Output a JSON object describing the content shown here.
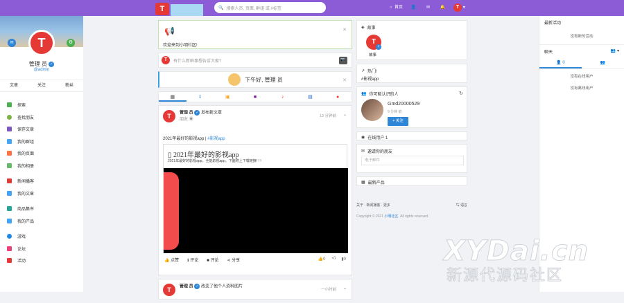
{
  "topbar": {
    "logo_text": "T",
    "search_placeholder": "搜索人员, 页面, 群组 或 #标签",
    "nav_home": "首页",
    "accent": "#8b5cd6"
  },
  "profile": {
    "name": "管理 员",
    "handle": "@admin",
    "tabs": [
      "文章",
      "关注",
      "粉丝"
    ]
  },
  "menu": [
    {
      "label": "探索",
      "color": "#4caf50"
    },
    {
      "label": "查找朋友",
      "color": "#7cb342"
    },
    {
      "label": "保存文章",
      "color": "#7e57c2"
    },
    {
      "label": "我的群组",
      "color": "#42a5f5"
    },
    {
      "label": "我的页面",
      "color": "#ff7043"
    },
    {
      "label": "我的相册",
      "color": "#66bb6a"
    },
    {
      "label": "新闻播客",
      "color": "#e53935"
    },
    {
      "label": "我的文章",
      "color": "#42a5f5"
    },
    {
      "label": "商品集市",
      "color": "#26a69a"
    },
    {
      "label": "我的产品",
      "color": "#42a5f5"
    },
    {
      "label": "游戏",
      "color": "#1e88e5"
    },
    {
      "label": "论坛",
      "color": "#ec407a"
    },
    {
      "label": "活动",
      "color": "#e53935"
    }
  ],
  "center": {
    "welcome": "欢迎来到小明社区!",
    "post_prompt": "有什么新鲜事想告诉大家?",
    "greeting": "下午好, 管理 员",
    "post1": {
      "author": "管理 员",
      "action": "发布新文章",
      "privacy": "朋友",
      "time": "13 分钟前",
      "text": "2021年最好的影视app |",
      "tag": "#影视app",
      "blog_title": "2021年最好的影视app",
      "blog_desc": "2021年最好的影视app。全能影视app。下面附上下载链接! ! !",
      "actions": [
        "点赞",
        "评论"
      ],
      "comment": "评论",
      "share": "分享",
      "likes": "0",
      "comments": "0",
      "shares": "0"
    },
    "post2": {
      "author": "管理 员",
      "action": "改变了他个人资料图片",
      "time": "一小时前"
    }
  },
  "right": {
    "story_title": "故事",
    "story_label": "故事",
    "hot_title": "热门!",
    "hot_tag": "#影视app",
    "pyk_title": "你可能认识的人",
    "pyk_name": "Gmd20000529",
    "pyk_time": "9 分钟 前",
    "pyk_follow": "关注",
    "online_title": "在线用户 1",
    "invite_title": "邀请你的朋友",
    "invite_placeholder": "电子邮件",
    "latest_title": "最新产品",
    "footer_links": "关于 · 新闻播客 · 更多",
    "footer_lang": "语言",
    "copyright_pre": "Copyright © 2021",
    "copyright_site": "小明社区",
    "copyright_post": ". All rights reserved."
  },
  "chat": {
    "recent_title": "最新活动",
    "recent_empty": "没有新的活动",
    "chat_title": "聊天",
    "tab_online": "0",
    "online_empty": "没有在线用户",
    "offline_empty": "没有离线用户"
  },
  "watermark": {
    "line1": "XYDai.cn",
    "line2": "新源代源码社区"
  }
}
